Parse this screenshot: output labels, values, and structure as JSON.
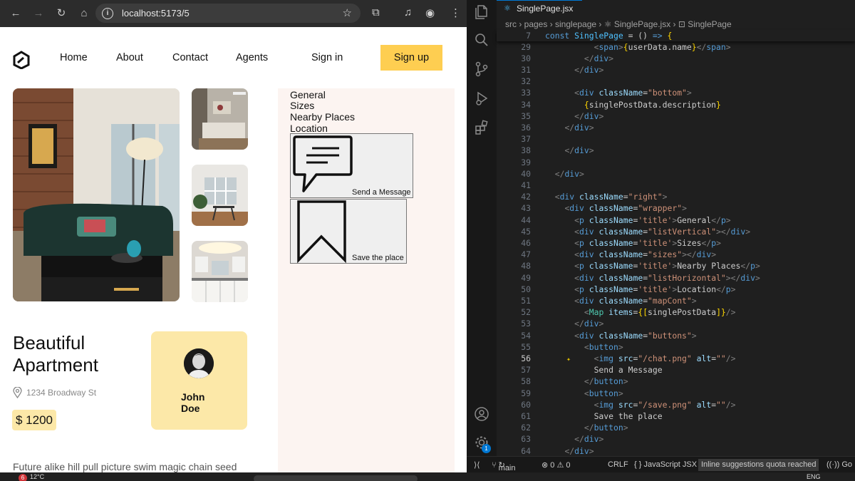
{
  "browser": {
    "url": "localhost:5173/5",
    "nav": {
      "home": "Home",
      "about": "About",
      "contact": "Contact",
      "agents": "Agents",
      "signin": "Sign in",
      "signup": "Sign up"
    },
    "property": {
      "title": "Beautiful Apartment",
      "address": "1234 Broadway St",
      "price": "$ 1200",
      "agent_name": "John Doe",
      "description": "Future alike hill pull picture swim magic chain seed"
    },
    "side": {
      "general": "General",
      "sizes": "Sizes",
      "nearby": "Nearby Places",
      "location": "Location",
      "send_message": "Send a Message",
      "save_place": "Save the place"
    },
    "colors": {
      "accent": "#fece51",
      "card": "#fce8a8",
      "panel": "#fcf4f1"
    }
  },
  "vscode": {
    "tab": "SinglePage.jsx",
    "tab_icon": "⚛",
    "breadcrumb": "src  ›  pages  ›  singlepage  ›  ⚛ SinglePage.jsx  ›  ⊡ SinglePage",
    "sticky": {
      "ln": "7",
      "code": "const SinglePage = () => {"
    },
    "lines": [
      {
        "ln": "29",
        "indent": "          ",
        "code": "<span>{userData.name}</span>"
      },
      {
        "ln": "30",
        "indent": "        ",
        "code": "</div>"
      },
      {
        "ln": "31",
        "indent": "      ",
        "code": "</div>"
      },
      {
        "ln": "32",
        "indent": "",
        "code": ""
      },
      {
        "ln": "33",
        "indent": "      ",
        "code": "<div className=\"bottom\">"
      },
      {
        "ln": "34",
        "indent": "        ",
        "code": "{singlePostData.description}"
      },
      {
        "ln": "35",
        "indent": "      ",
        "code": "</div>"
      },
      {
        "ln": "36",
        "indent": "    ",
        "code": "</div>"
      },
      {
        "ln": "37",
        "indent": "",
        "code": ""
      },
      {
        "ln": "38",
        "indent": "    ",
        "code": "</div>"
      },
      {
        "ln": "39",
        "indent": "",
        "code": ""
      },
      {
        "ln": "40",
        "indent": "  ",
        "code": "</div>"
      },
      {
        "ln": "41",
        "indent": "",
        "code": ""
      },
      {
        "ln": "42",
        "indent": "  ",
        "code": "<div className=\"right\">"
      },
      {
        "ln": "43",
        "indent": "    ",
        "code": "<div className=\"wrapper\">"
      },
      {
        "ln": "44",
        "indent": "      ",
        "code": "<p className='title'>General</p>"
      },
      {
        "ln": "45",
        "indent": "      ",
        "code": "<div className=\"listVertical\"></div>"
      },
      {
        "ln": "46",
        "indent": "      ",
        "code": "<p className='title'>Sizes</p>"
      },
      {
        "ln": "47",
        "indent": "      ",
        "code": "<div className=\"sizes\"></div>"
      },
      {
        "ln": "48",
        "indent": "      ",
        "code": "<p className='title'>Nearby Places</p>"
      },
      {
        "ln": "49",
        "indent": "      ",
        "code": "<div className=\"listHorizontal\"></div>"
      },
      {
        "ln": "50",
        "indent": "      ",
        "code": "<p className='title'>Location</p>"
      },
      {
        "ln": "51",
        "indent": "      ",
        "code": "<div className=\"mapCont\">"
      },
      {
        "ln": "52",
        "indent": "        ",
        "code": "<Map items={[singlePostData]}/>"
      },
      {
        "ln": "53",
        "indent": "      ",
        "code": "</div>"
      },
      {
        "ln": "54",
        "indent": "      ",
        "code": "<div className=\"buttons\">"
      },
      {
        "ln": "55",
        "indent": "        ",
        "code": "<button>"
      },
      {
        "ln": "56",
        "indent": "          ",
        "code": "<img src=\"/chat.png\" alt=\"\"/>"
      },
      {
        "ln": "57",
        "indent": "          ",
        "code": "Send a Message"
      },
      {
        "ln": "58",
        "indent": "        ",
        "code": "</button>"
      },
      {
        "ln": "59",
        "indent": "        ",
        "code": "<button>"
      },
      {
        "ln": "60",
        "indent": "          ",
        "code": "<img src=\"/save.png\" alt=\"\"/>"
      },
      {
        "ln": "61",
        "indent": "          ",
        "code": "Save the place"
      },
      {
        "ln": "62",
        "indent": "        ",
        "code": "</button>"
      },
      {
        "ln": "63",
        "indent": "      ",
        "code": "</div>"
      },
      {
        "ln": "64",
        "indent": "    ",
        "code": "</div>"
      }
    ],
    "current_line": "56",
    "status": {
      "branch": "main",
      "problems": "⊗ 0 ⚠ 0",
      "eol": "CRLF",
      "language": "{ } JavaScript JSX",
      "quota": "Inline suggestions quota reached",
      "golive": "((·)) Go Li"
    }
  },
  "taskbar": {
    "weather_badge": "6",
    "temp": "12°C",
    "lang": "ENG"
  }
}
